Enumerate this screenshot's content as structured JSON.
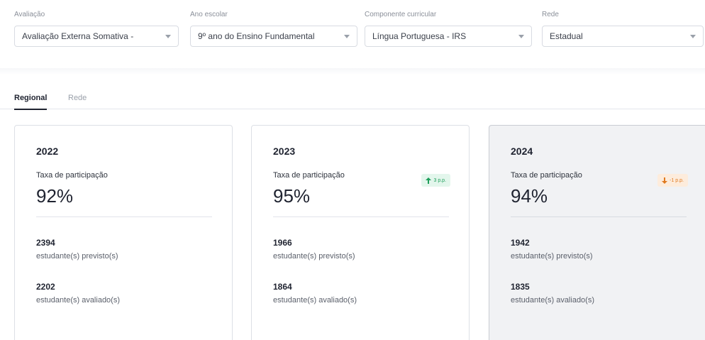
{
  "filters": [
    {
      "label": "Avaliação",
      "value": "Avaliação Externa Somativa -",
      "icon": "chevron-down-icon"
    },
    {
      "label": "Ano escolar",
      "value": "9º ano do Ensino Fundamental",
      "icon": "chevron-down-icon"
    },
    {
      "label": "Componente curricular",
      "value": "Língua Portuguesa - IRS",
      "icon": "chevron-down-icon"
    },
    {
      "label": "Rede",
      "value": "Estadual",
      "icon": "chevron-down-icon"
    }
  ],
  "tabs": [
    {
      "label": "Regional",
      "active": true
    },
    {
      "label": "Rede",
      "active": false
    }
  ],
  "cards": [
    {
      "year": "2022",
      "rate_label": "Taxa de participação",
      "rate": "92%",
      "expected_value": "2394",
      "expected_label": "estudante(s) previsto(s)",
      "evaluated_value": "2202",
      "evaluated_label": "estudante(s) avaliado(s)",
      "selected": false
    },
    {
      "year": "2023",
      "rate_label": "Taxa de participação",
      "rate": "95%",
      "badge": {
        "text": "3 p.p.",
        "direction": "up",
        "icon": "arrow-up-icon",
        "color": "#1e9e5a",
        "bg": "#e3f6ec"
      },
      "expected_value": "1966",
      "expected_label": "estudante(s) previsto(s)",
      "evaluated_value": "1864",
      "evaluated_label": "estudante(s) avaliado(s)",
      "selected": false
    },
    {
      "year": "2024",
      "rate_label": "Taxa de participação",
      "rate": "94%",
      "badge": {
        "text": "-1 p.p.",
        "direction": "down",
        "icon": "arrow-down-icon",
        "color": "#e07a1f",
        "bg": "#fdecdc"
      },
      "expected_value": "1942",
      "expected_label": "estudante(s) previsto(s)",
      "evaluated_value": "1835",
      "evaluated_label": "estudante(s) avaliado(s)",
      "selected": true
    }
  ]
}
